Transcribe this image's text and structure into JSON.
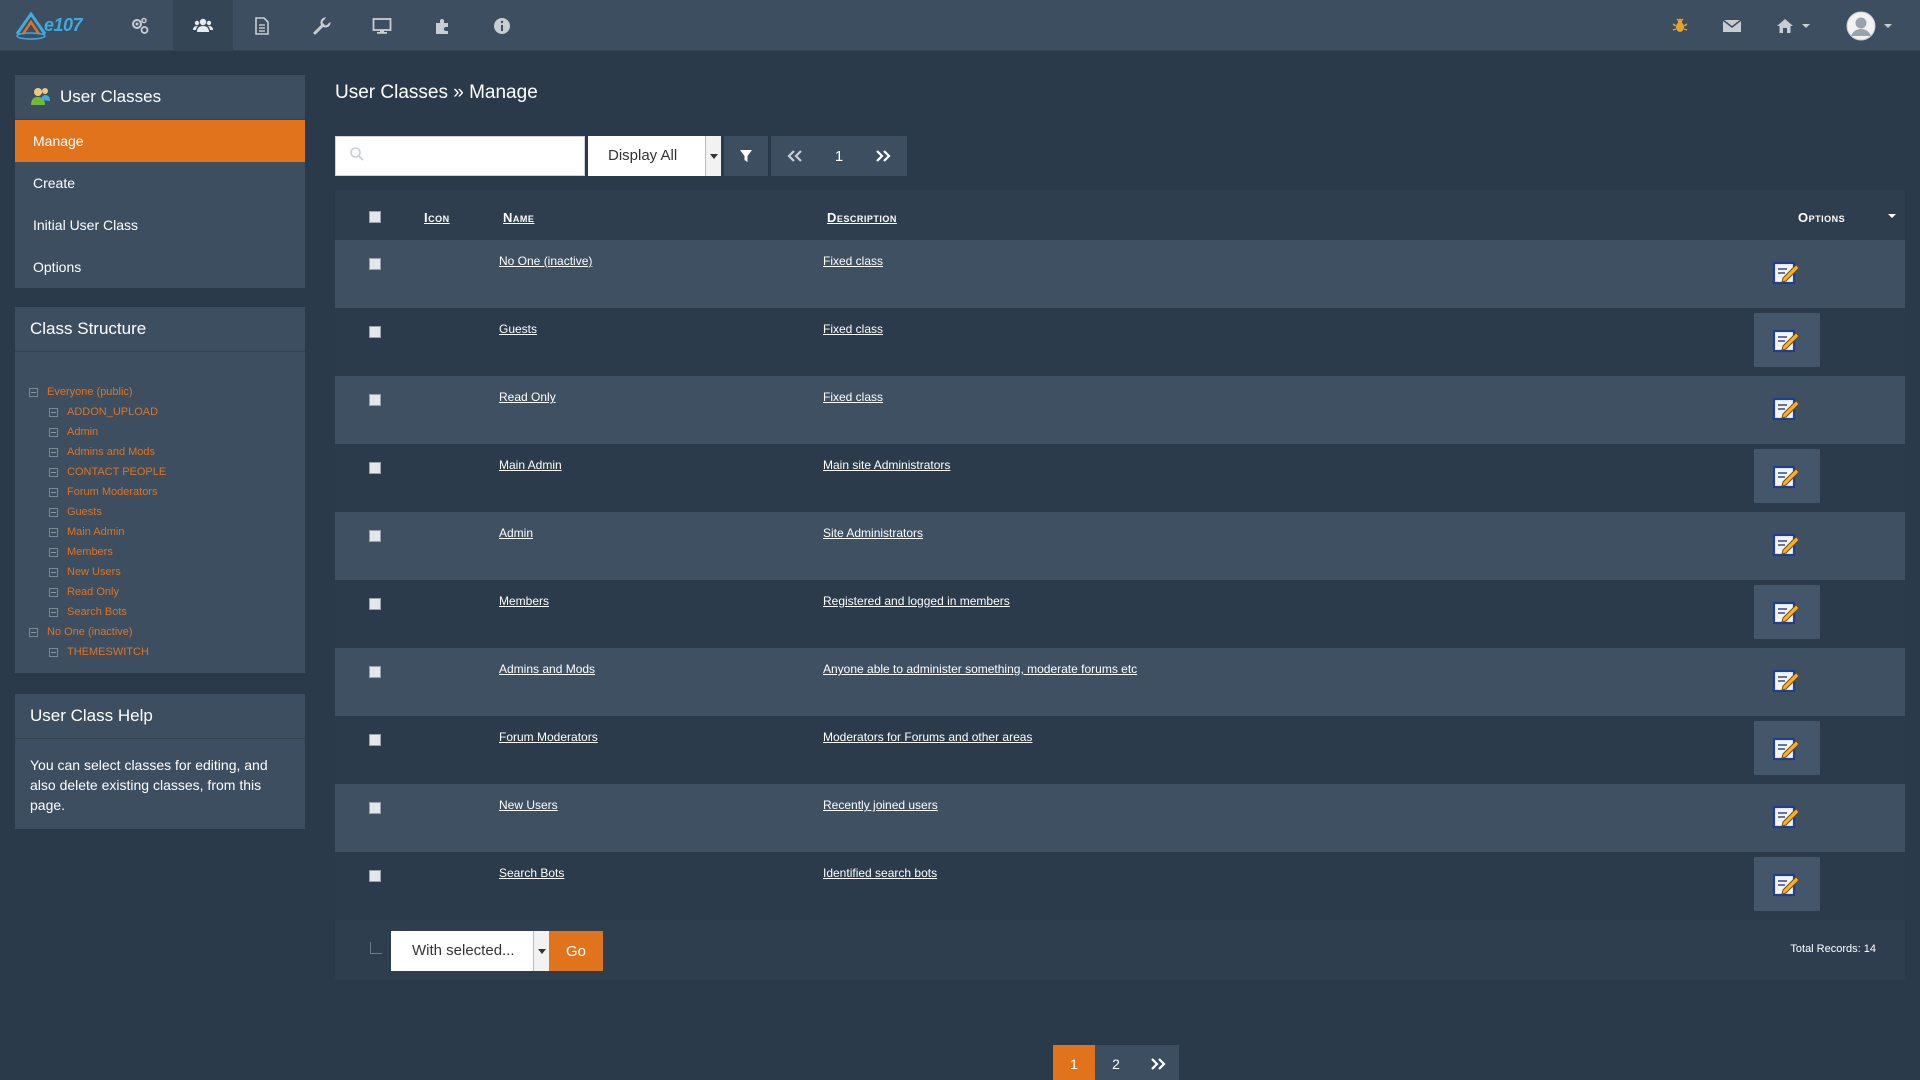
{
  "app": {
    "logo_text": "e107"
  },
  "colors": {
    "accent": "#e2731d",
    "bg": "#2b3a4a",
    "navbar": "#3d4e60",
    "link_tree": "#e2731d"
  },
  "topnav": {
    "icons": [
      "settings-icon",
      "users-icon",
      "content-icon",
      "tools-icon",
      "display-icon",
      "plugins-icon",
      "info-icon"
    ],
    "right_icons": [
      "debug-icon",
      "mail-icon",
      "home-icon",
      "user-avatar"
    ]
  },
  "sidebar": {
    "title": "User Classes",
    "items": [
      {
        "label": "Manage",
        "active": true
      },
      {
        "label": "Create",
        "active": false
      },
      {
        "label": "Initial User Class",
        "active": false
      },
      {
        "label": "Options",
        "active": false
      }
    ],
    "structure_title": "Class Structure",
    "tree": [
      {
        "label": "Everyone (public)",
        "level": 1
      },
      {
        "label": "ADDON_UPLOAD",
        "level": 2
      },
      {
        "label": "Admin",
        "level": 2
      },
      {
        "label": "Admins and Mods",
        "level": 2
      },
      {
        "label": "CONTACT PEOPLE",
        "level": 2
      },
      {
        "label": "Forum Moderators",
        "level": 2
      },
      {
        "label": "Guests",
        "level": 2
      },
      {
        "label": "Main Admin",
        "level": 2
      },
      {
        "label": "Members",
        "level": 2
      },
      {
        "label": "New Users",
        "level": 2
      },
      {
        "label": "Read Only",
        "level": 2
      },
      {
        "label": "Search Bots",
        "level": 2
      },
      {
        "label": "No One (inactive)",
        "level": 1
      },
      {
        "label": "THEMESWITCH",
        "level": 2
      }
    ],
    "help_title": "User Class Help",
    "help_text": "You can select classes for editing, and also delete existing classes, from this page."
  },
  "main": {
    "breadcrumb": "User Classes » Manage",
    "search": {
      "value": "",
      "placeholder": ""
    },
    "filter_select": "Display All",
    "page_current": "1",
    "columns": {
      "icon": "Icon",
      "name": "Name",
      "description": "Description",
      "options": "Options"
    },
    "rows": [
      {
        "name": "No One (inactive)",
        "description": "Fixed class"
      },
      {
        "name": "Guests",
        "description": "Fixed class"
      },
      {
        "name": "Read Only",
        "description": "Fixed class"
      },
      {
        "name": "Main Admin",
        "description": "Main site Administrators"
      },
      {
        "name": "Admin",
        "description": "Site Administrators"
      },
      {
        "name": "Members",
        "description": "Registered and logged in members"
      },
      {
        "name": "Admins and Mods",
        "description": "Anyone able to administer something, moderate forums etc"
      },
      {
        "name": "Forum Moderators",
        "description": "Moderators for Forums and other areas"
      },
      {
        "name": "New Users",
        "description": "Recently joined users"
      },
      {
        "name": "Search Bots",
        "description": "Identified search bots"
      }
    ],
    "bulk_select": "With selected...",
    "go_label": "Go",
    "total_records": "Total Records: 14",
    "pagination": [
      "1",
      "2"
    ]
  }
}
